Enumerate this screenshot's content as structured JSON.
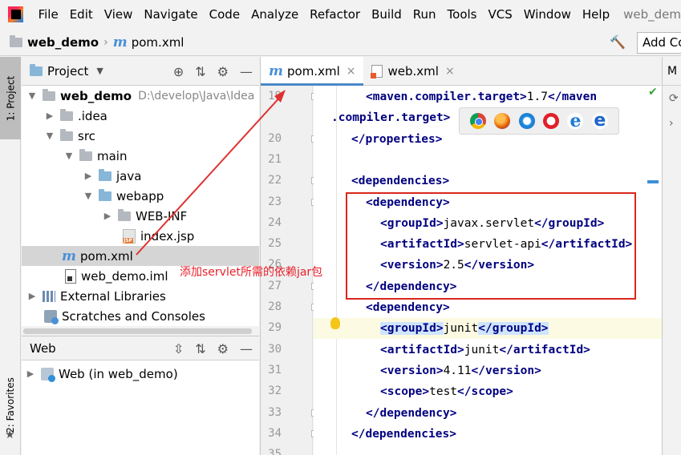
{
  "menubar": {
    "items": [
      "File",
      "Edit",
      "View",
      "Navigate",
      "Code",
      "Analyze",
      "Refactor",
      "Build",
      "Run",
      "Tools",
      "VCS",
      "Window",
      "Help"
    ],
    "title": "web_dem"
  },
  "breadcrumb": {
    "project": "web_demo",
    "file": "pom.xml",
    "add_config": "Add Co"
  },
  "left_stripe": {
    "project_tab": "1: Project",
    "favorites_tab": "2: Favorites"
  },
  "project_panel": {
    "title": "Project",
    "tree": [
      {
        "label": "web_demo",
        "path": "D:\\develop\\Java\\Idea"
      },
      {
        "label": ".idea"
      },
      {
        "label": "src"
      },
      {
        "label": "main"
      },
      {
        "label": "java"
      },
      {
        "label": "webapp"
      },
      {
        "label": "WEB-INF"
      },
      {
        "label": "index.jsp"
      },
      {
        "label": "pom.xml"
      },
      {
        "label": "web_demo.iml"
      },
      {
        "label": "External Libraries"
      },
      {
        "label": "Scratches and Consoles"
      }
    ]
  },
  "web_panel": {
    "title": "Web",
    "item": "Web (in web_demo)"
  },
  "editor": {
    "tabs": [
      {
        "label": "pom.xml"
      },
      {
        "label": "web.xml"
      }
    ],
    "lines": [
      {
        "num": "19",
        "parts": [
          [
            "tag",
            "<maven.compiler.target>"
          ],
          [
            "txt",
            "1.7"
          ],
          [
            "tag",
            "</maven"
          ]
        ]
      },
      {
        "num": "",
        "parts": [
          [
            "tag",
            ".compiler.target>"
          ]
        ]
      },
      {
        "num": "20",
        "parts": [
          [
            "tag",
            "</properties>"
          ]
        ]
      },
      {
        "num": "21",
        "parts": []
      },
      {
        "num": "22",
        "parts": [
          [
            "tag",
            "<dependencies>"
          ]
        ]
      },
      {
        "num": "23",
        "parts": [
          [
            "tag",
            "<dependency>"
          ]
        ]
      },
      {
        "num": "24",
        "parts": [
          [
            "tag",
            "<groupId>"
          ],
          [
            "txt",
            "javax.servlet"
          ],
          [
            "tag",
            "</groupId>"
          ]
        ]
      },
      {
        "num": "25",
        "parts": [
          [
            "tag",
            "<artifactId>"
          ],
          [
            "txt",
            "servlet-api"
          ],
          [
            "tag",
            "</artifactId>"
          ]
        ]
      },
      {
        "num": "26",
        "parts": [
          [
            "tag",
            "<version>"
          ],
          [
            "txt",
            "2.5"
          ],
          [
            "tag",
            "</version>"
          ]
        ]
      },
      {
        "num": "27",
        "parts": [
          [
            "tag",
            "</dependency>"
          ]
        ]
      },
      {
        "num": "28",
        "parts": [
          [
            "tag",
            "<dependency>"
          ]
        ]
      },
      {
        "num": "29",
        "parts": [
          [
            "hltag",
            "<groupId>"
          ],
          [
            "txt",
            "junit"
          ],
          [
            "hltag",
            "</groupId>"
          ]
        ]
      },
      {
        "num": "30",
        "parts": [
          [
            "tag",
            "<artifactId>"
          ],
          [
            "txt",
            "junit"
          ],
          [
            "tag",
            "</artifactId>"
          ]
        ]
      },
      {
        "num": "31",
        "parts": [
          [
            "tag",
            "<version>"
          ],
          [
            "txt",
            "4.11"
          ],
          [
            "tag",
            "</version>"
          ]
        ]
      },
      {
        "num": "32",
        "parts": [
          [
            "tag",
            "<scope>"
          ],
          [
            "txt",
            "test"
          ],
          [
            "tag",
            "</scope>"
          ]
        ]
      },
      {
        "num": "33",
        "parts": [
          [
            "tag",
            "</dependency>"
          ]
        ]
      },
      {
        "num": "34",
        "parts": [
          [
            "tag",
            "</dependencies>"
          ]
        ]
      },
      {
        "num": "35",
        "parts": []
      }
    ],
    "annotation": "添加servlet所需的依赖jar包"
  },
  "browser_popup": {
    "icons": [
      "chrome-icon",
      "firefox-icon",
      "safari-icon",
      "opera-icon",
      "ie-icon",
      "edge-icon"
    ],
    "ie_glyph": "e",
    "edge_glyph": "e"
  },
  "right_stripe": {
    "tab": "M"
  },
  "colors": {
    "accent": "#4a88c7",
    "tag": "#000080",
    "annotation_red": "#e8202a",
    "current_line": "#fcfae2"
  }
}
